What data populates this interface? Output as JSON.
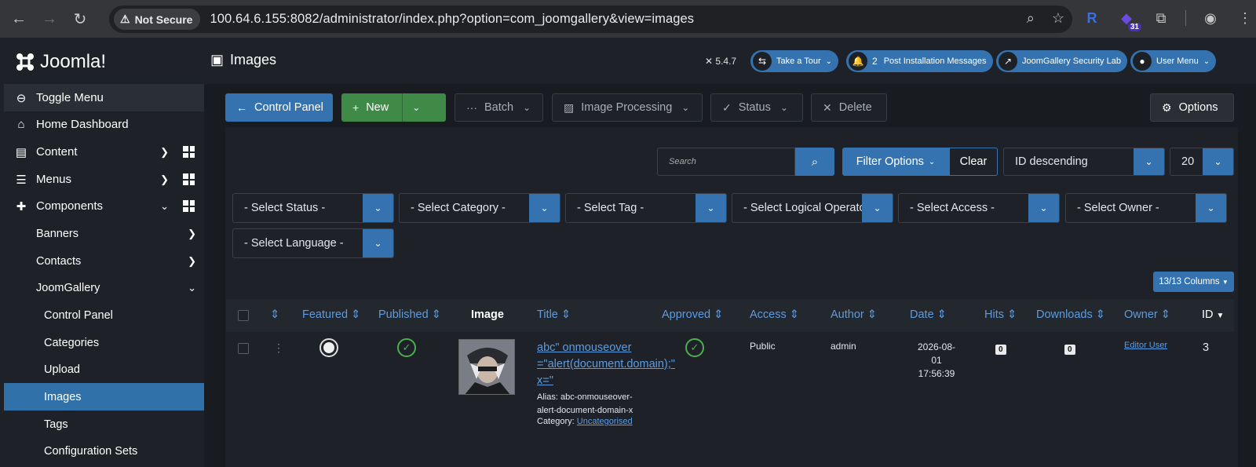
{
  "browser": {
    "security_label": "Not Secure",
    "url": "100.64.6.155:8082/administrator/index.php?option=com_joomgallery&view=images",
    "extension_badge": "31"
  },
  "sidebar": {
    "logo_text": "Joomla!",
    "items": [
      {
        "label": "Toggle Menu"
      },
      {
        "label": "Home Dashboard"
      },
      {
        "label": "Content"
      },
      {
        "label": "Menus"
      },
      {
        "label": "Components"
      }
    ],
    "sub_items": [
      {
        "label": "Banners"
      },
      {
        "label": "Contacts"
      },
      {
        "label": "JoomGallery"
      },
      {
        "label": "Control Panel"
      },
      {
        "label": "Categories"
      },
      {
        "label": "Upload"
      },
      {
        "label": "Images"
      },
      {
        "label": "Tags"
      },
      {
        "label": "Configuration Sets"
      }
    ]
  },
  "header": {
    "title": "Images",
    "version": "5.4.7",
    "take_tour": "Take a Tour",
    "post_install_count": "2",
    "post_install": "Post Installation Messages",
    "security_lab": "JoomGallery Security Lab",
    "user_menu": "User Menu"
  },
  "toolbar": {
    "control_panel": "Control Panel",
    "new": "New",
    "batch": "Batch",
    "image_processing": "Image Processing",
    "status": "Status",
    "delete": "Delete",
    "options": "Options"
  },
  "search": {
    "placeholder": "Search",
    "filter_options": "Filter Options",
    "clear": "Clear",
    "ordering": "ID descending",
    "limit": "20"
  },
  "filters": {
    "status": "- Select Status -",
    "category": "- Select Category -",
    "tag": "- Select Tag -",
    "logical": "- Select Logical Operator -",
    "access": "- Select Access -",
    "owner": "- Select Owner -",
    "language": "- Select Language -"
  },
  "columns_button": "13/13 Columns",
  "table": {
    "headers": {
      "featured": "Featured",
      "published": "Published",
      "image": "Image",
      "title": "Title",
      "approved": "Approved",
      "access": "Access",
      "author": "Author",
      "date": "Date",
      "hits": "Hits",
      "downloads": "Downloads",
      "owner": "Owner",
      "id": "ID"
    },
    "rows": [
      {
        "title": "abc\" onmouseover =\"alert(document.domain);\" x=\"",
        "alias_label": "Alias:",
        "alias": "abc-onmouseover-alert-document-domain-x",
        "category_label": "Category:",
        "category": "Uncategorised",
        "access": "Public",
        "author": "admin",
        "date": "2026-08-01",
        "time": "17:56:39",
        "hits": "0",
        "downloads": "0",
        "owner": "Editor User",
        "id": "3"
      }
    ]
  }
}
